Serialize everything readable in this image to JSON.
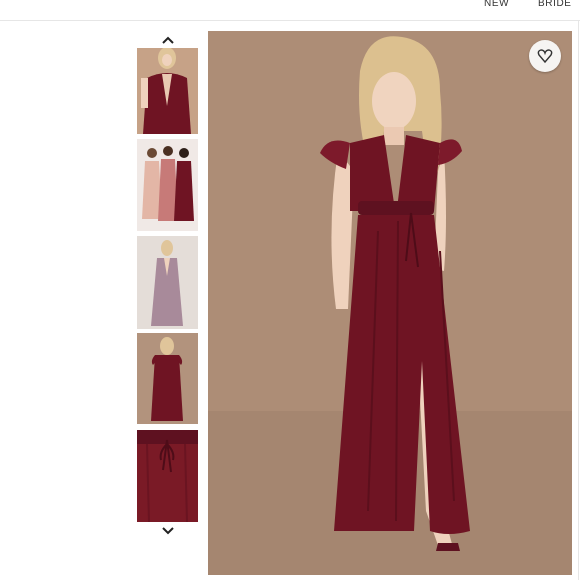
{
  "nav": {
    "new_label": "NEW",
    "bride_label": "BRIDE"
  },
  "gallery": {
    "thumbnails": [
      "model-front-thumbnail",
      "group-bridesmaids-thumbnail",
      "mauve-dress-thumbnail",
      "back-view-thumbnail",
      "waist-tie-detail-thumbnail"
    ],
    "active_index": 0
  },
  "icons": {
    "up": "chevron-up-icon",
    "down": "chevron-down-icon",
    "favorite": "heart-icon"
  },
  "colors": {
    "dress": "#6f1423",
    "backdrop": "#ad8d76",
    "hair": "#e0c59a",
    "skin": "#f0d4bf"
  }
}
